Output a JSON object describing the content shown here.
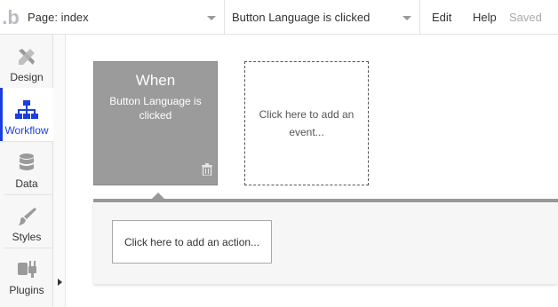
{
  "header": {
    "logo_text": ".b",
    "page_select": "Page: index",
    "workflow_select": "Button Language is clicked",
    "menu": {
      "edit": "Edit",
      "help": "Help",
      "saved": "Saved"
    }
  },
  "sidebar": {
    "items": [
      {
        "label": "Design",
        "icon": "design-tools-icon",
        "active": false
      },
      {
        "label": "Workflow",
        "icon": "workflow-icon",
        "active": true
      },
      {
        "label": "Data",
        "icon": "database-icon",
        "active": false
      },
      {
        "label": "Styles",
        "icon": "brush-icon",
        "active": false
      },
      {
        "label": "Plugins",
        "icon": "plug-icon",
        "active": false
      }
    ]
  },
  "workflow": {
    "event_card": {
      "title": "When",
      "subtitle": "Button Language is clicked",
      "icon": "trash-icon"
    },
    "add_event": "Click here to add an event...",
    "add_action": "Click here to add an action..."
  },
  "colors": {
    "accent": "#1a3fdc",
    "event_card": "#9b9b9b",
    "panel": "#f6f6f6"
  }
}
